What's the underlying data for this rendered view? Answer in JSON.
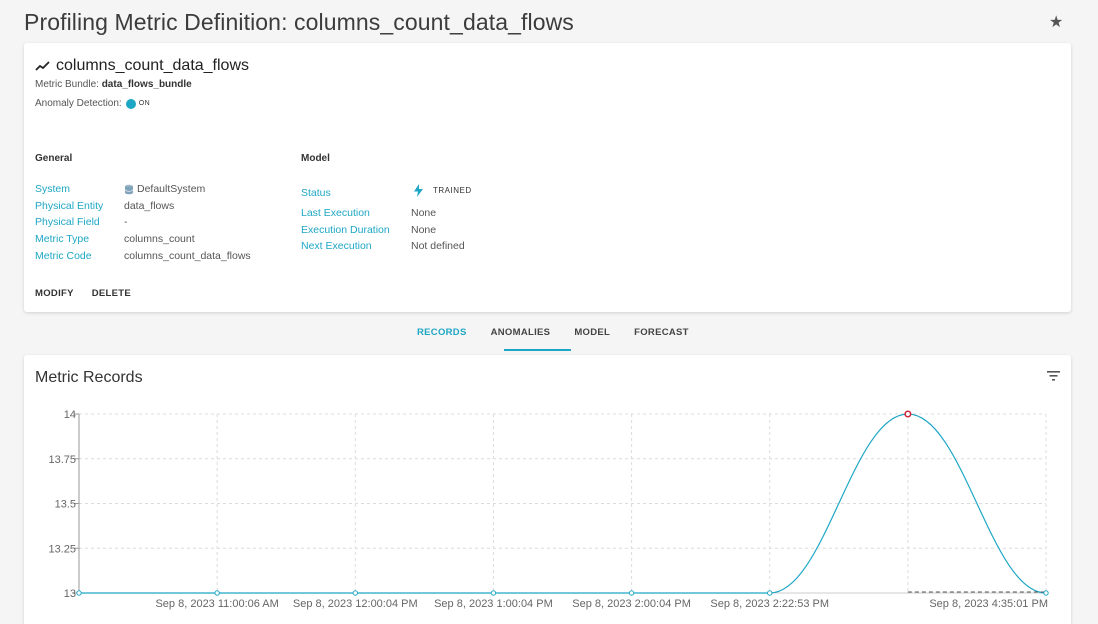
{
  "header": {
    "title": "Profiling Metric Definition: columns_count_data_flows",
    "favorite_icon": "star-icon"
  },
  "definition": {
    "metric_name": "columns_count_data_flows",
    "metric_icon": "trending-icon",
    "bundle_label": "Metric Bundle:",
    "bundle_value": "data_flows_bundle",
    "anomaly_label": "Anomaly Detection:",
    "anomaly_value": "ON",
    "general": {
      "title": "General",
      "rows": [
        {
          "key": "System",
          "value": "DefaultSystem",
          "icon": "database-icon"
        },
        {
          "key": "Physical Entity",
          "value": "data_flows"
        },
        {
          "key": "Physical Field",
          "value": "-"
        },
        {
          "key": "Metric Type",
          "value": "columns_count"
        },
        {
          "key": "Metric Code",
          "value": "columns_count_data_flows"
        }
      ]
    },
    "model": {
      "title": "Model",
      "rows": [
        {
          "key": "Status",
          "value": "TRAINED",
          "icon": "bolt-icon"
        },
        {
          "key": "Last Execution",
          "value": "None"
        },
        {
          "key": "Execution Duration",
          "value": "None"
        },
        {
          "key": "Next Execution",
          "value": "Not defined"
        }
      ]
    },
    "actions": {
      "modify": "MODIFY",
      "delete": "DELETE"
    }
  },
  "tabs": [
    {
      "label": "RECORDS",
      "active": true
    },
    {
      "label": "ANOMALIES",
      "active": false
    },
    {
      "label": "MODEL",
      "active": false
    },
    {
      "label": "FORECAST",
      "active": false
    }
  ],
  "records": {
    "title": "Metric Records",
    "filter_icon": "filter-icon"
  },
  "colors": {
    "accent": "#1ea7c5",
    "anomaly_point": "#d0243a"
  },
  "chart_data": {
    "type": "line",
    "yticks": [
      13,
      13.25,
      13.5,
      13.75,
      14
    ],
    "ytick_labels": [
      "13",
      "13.25",
      "13.5",
      "13.75",
      "14"
    ],
    "ylim": [
      13,
      14
    ],
    "xtick_labels": [
      "Sep 8, 2023 11:00:06 AM",
      "Sep 8, 2023 12:00:04 PM",
      "Sep 8, 2023 1:00:04 PM",
      "Sep 8, 2023 2:00:04 PM",
      "Sep 8, 2023 2:22:53 PM",
      "Sep 8, 2023 4:35:01 PM"
    ],
    "points": [
      {
        "y": 13
      },
      {
        "y": 13
      },
      {
        "y": 13
      },
      {
        "y": 13
      },
      {
        "y": 13
      },
      {
        "y": 13
      },
      {
        "y": 14,
        "anomaly": true
      },
      {
        "y": 13
      }
    ],
    "grid": true
  }
}
